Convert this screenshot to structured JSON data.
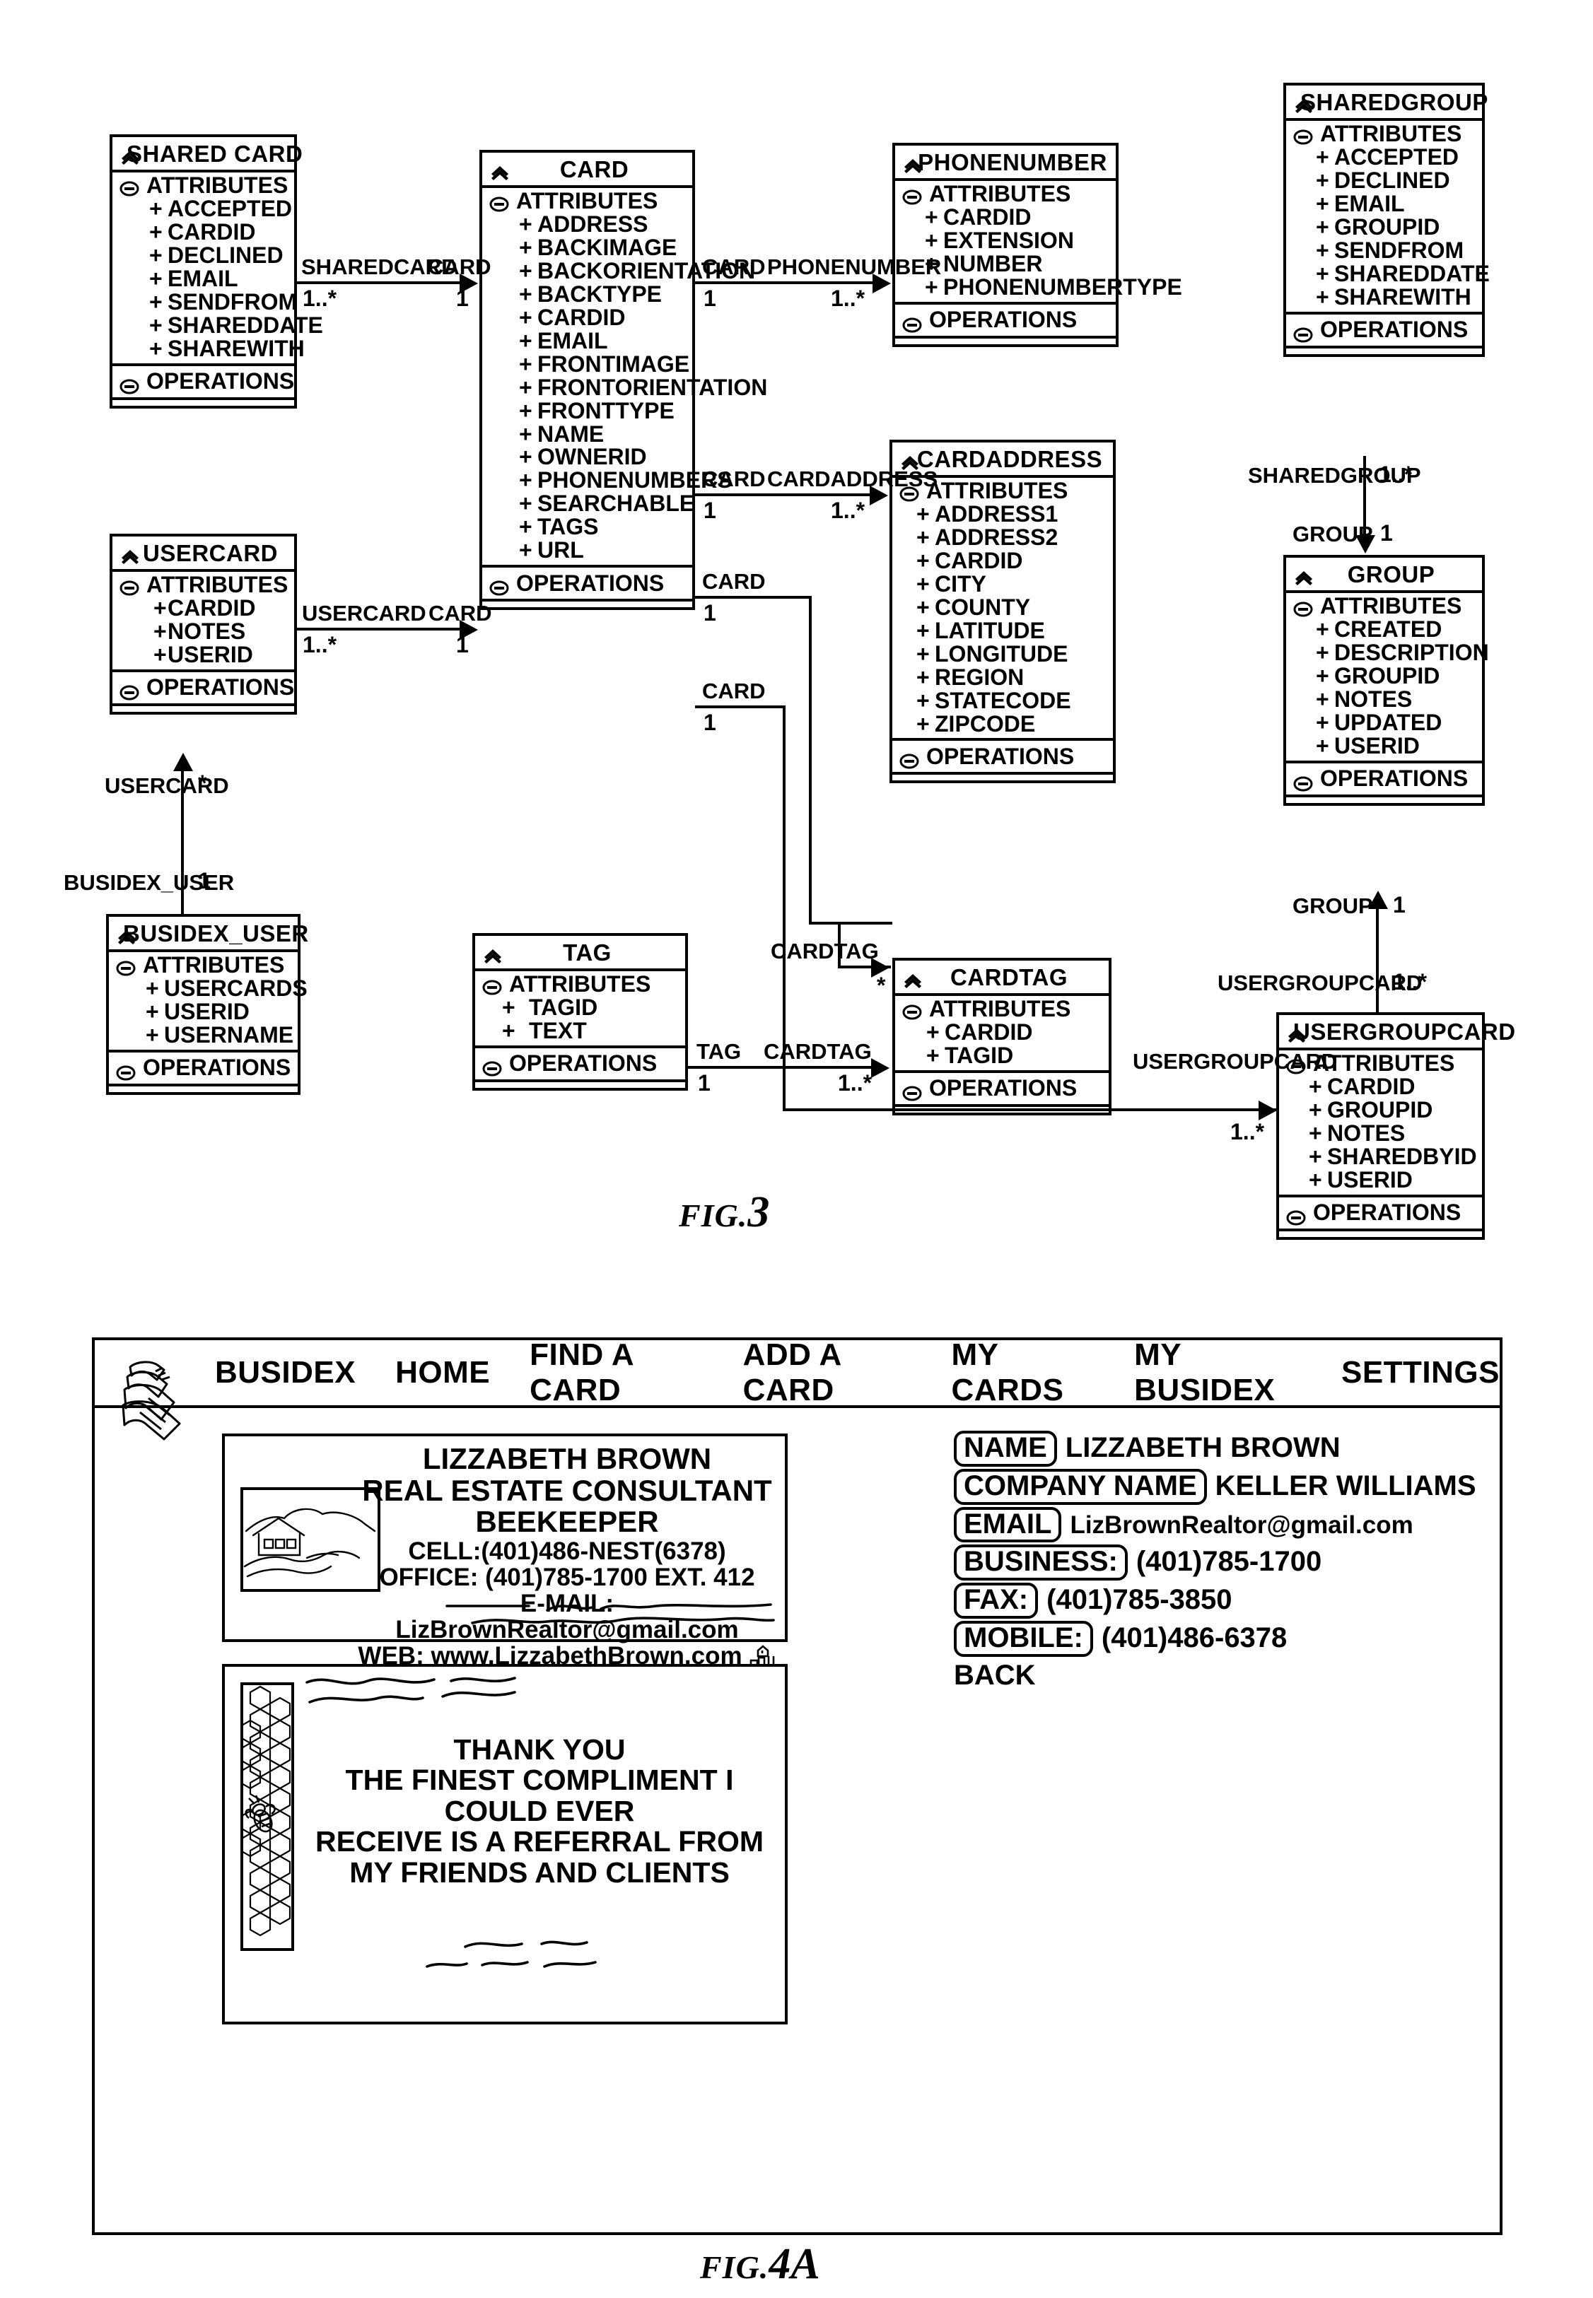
{
  "figures": {
    "fig3": {
      "word": "FIG.",
      "number": "3"
    },
    "fig4a": {
      "word": "FIG.",
      "number": "4A"
    }
  },
  "uml": {
    "sections": {
      "attributes": "ATTRIBUTES",
      "operations": "OPERATIONS"
    },
    "classes": [
      {
        "id": "sharedcard",
        "name": "SHARED CARD",
        "attributes": [
          "ACCEPTED",
          "CARDID",
          "DECLINED",
          "EMAIL",
          "SENDFROM",
          "SHAREDDATE",
          "SHAREWITH"
        ]
      },
      {
        "id": "usercard",
        "name": "USERCARD",
        "attributes": [
          "CARDID",
          "NOTES",
          "USERID"
        ]
      },
      {
        "id": "busidex_user",
        "name": "BUSIDEX_USER",
        "attributes": [
          "USERCARDS",
          "USERID",
          "USERNAME"
        ]
      },
      {
        "id": "card",
        "name": "CARD",
        "attributes": [
          "ADDRESS",
          "BACKIMAGE",
          "BACKORIENTATION",
          "BACKTYPE",
          "CARDID",
          "EMAIL",
          "FRONTIMAGE",
          "FRONTORIENTATION",
          "FRONTTYPE",
          "NAME",
          "OWNERID",
          "PHONENUMBERS",
          "SEARCHABLE",
          "TAGS",
          "URL"
        ]
      },
      {
        "id": "tag",
        "name": "TAG",
        "attributes": [
          "TAGID",
          "TEXT"
        ]
      },
      {
        "id": "phonenumber",
        "name": "PHONENUMBER",
        "attributes": [
          "CARDID",
          "EXTENSION",
          "NUMBER",
          "PHONENUMBERTYPE"
        ]
      },
      {
        "id": "cardaddress",
        "name": "CARDADDRESS",
        "attributes": [
          "ADDRESS1",
          "ADDRESS2",
          "CARDID",
          "CITY",
          "COUNTY",
          "LATITUDE",
          "LONGITUDE",
          "REGION",
          "STATECODE",
          "ZIPCODE"
        ]
      },
      {
        "id": "cardtag",
        "name": "CARDTAG",
        "attributes": [
          "CARDID",
          "TAGID"
        ]
      },
      {
        "id": "sharedgroup",
        "name": "SHAREDGROUP",
        "attributes": [
          "ACCEPTED",
          "DECLINED",
          "EMAIL",
          "GROUPID",
          "SENDFROM",
          "SHAREDDATE",
          "SHAREWITH"
        ]
      },
      {
        "id": "group",
        "name": "GROUP",
        "attributes": [
          "CREATED",
          "DESCRIPTION",
          "GROUPID",
          "NOTES",
          "UPDATED",
          "USERID"
        ]
      },
      {
        "id": "usergroupcard",
        "name": "USERGROUPCARD",
        "attributes": [
          "CARDID",
          "GROUPID",
          "NOTES",
          "SHAREDBYID",
          "USERID"
        ]
      }
    ],
    "relations": [
      {
        "id": "sharedcard-card",
        "source_label": "SHAREDCARD",
        "target_label": "CARD",
        "source_mult": "1..*",
        "target_mult": "1"
      },
      {
        "id": "usercard-card",
        "source_label": "USERCARD",
        "target_label": "CARD",
        "source_mult": "1..*",
        "target_mult": "1"
      },
      {
        "id": "busidexuser-usercard",
        "source_label": "USERCARD",
        "target_label": "BUSIDEX_USER",
        "source_mult": "*",
        "target_mult": "1"
      },
      {
        "id": "card-phonenumber",
        "source_label": "CARD",
        "target_label": "PHONENUMBER",
        "source_mult": "1",
        "target_mult": "1..*"
      },
      {
        "id": "card-cardaddress",
        "source_label": "CARD",
        "target_label": "CARDADDRESS",
        "source_mult": "1",
        "target_mult": "1..*"
      },
      {
        "id": "card-cardtag",
        "source_label": "CARD",
        "target_label": "CARDTAG",
        "source_mult": "1",
        "target_mult": "*"
      },
      {
        "id": "card-usergroupcard",
        "source_label": "CARD",
        "target_label": "USERGROUPCARD",
        "source_mult": "1",
        "target_mult": "1..*"
      },
      {
        "id": "tag-cardtag",
        "source_label": "TAG",
        "target_label": "CARDTAG",
        "source_mult": "1",
        "target_mult": "1..*"
      },
      {
        "id": "sharedgroup-group",
        "source_label": "SHAREDGROUP",
        "target_label": "GROUP",
        "source_mult": "1..*",
        "target_mult": "1"
      },
      {
        "id": "usergroupcard-group",
        "source_label": "USERGROUPCARD",
        "target_label": "GROUP",
        "source_mult": "1..*",
        "target_mult": "1"
      }
    ]
  },
  "app": {
    "nav": [
      {
        "id": "busidex",
        "label": "BUSIDEX"
      },
      {
        "id": "home",
        "label": "HOME"
      },
      {
        "id": "find-a-card",
        "label": "FIND A CARD"
      },
      {
        "id": "add-a-card",
        "label": "ADD A CARD"
      },
      {
        "id": "my-cards",
        "label": "MY CARDS"
      },
      {
        "id": "my-busidex",
        "label": "MY BUSIDEX"
      },
      {
        "id": "settings",
        "label": "SETTINGS"
      }
    ],
    "business_card_front": {
      "name": "LIZZABETH BROWN",
      "title": "REAL ESTATE CONSULTANT",
      "subtitle": "BEEKEEPER",
      "cell": "CELL:(401)486-NEST(6378)",
      "office": "OFFICE: (401)785-1700 EXT. 412",
      "email": "E-MAIL: LizBrownRealtor@gmail.com",
      "web": "WEB: www.LizzabethBrown.com"
    },
    "business_card_back": {
      "line1": "THANK YOU",
      "line2": "THE FINEST COMPLIMENT I COULD EVER",
      "line3": "RECEIVE IS A REFERRAL FROM",
      "line4": "MY FRIENDS AND CLIENTS"
    },
    "details": {
      "rows": [
        {
          "id": "name",
          "label": "NAME",
          "value": "LIZZABETH BROWN",
          "small": false
        },
        {
          "id": "company-name",
          "label": "COMPANY NAME",
          "value": "KELLER WILLIAMS",
          "small": false
        },
        {
          "id": "email",
          "label": "EMAIL",
          "value": "LizBrownRealtor@gmail.com",
          "small": true
        },
        {
          "id": "business",
          "label": "BUSINESS:",
          "value": "(401)785-1700",
          "small": false
        },
        {
          "id": "fax",
          "label": "FAX:",
          "value": "(401)785-3850",
          "small": false
        },
        {
          "id": "mobile",
          "label": "MOBILE:",
          "value": "(401)486-6378",
          "small": false
        }
      ],
      "back_label": "BACK"
    }
  },
  "colors": {
    "ink": "#000000",
    "paper": "#ffffff"
  }
}
